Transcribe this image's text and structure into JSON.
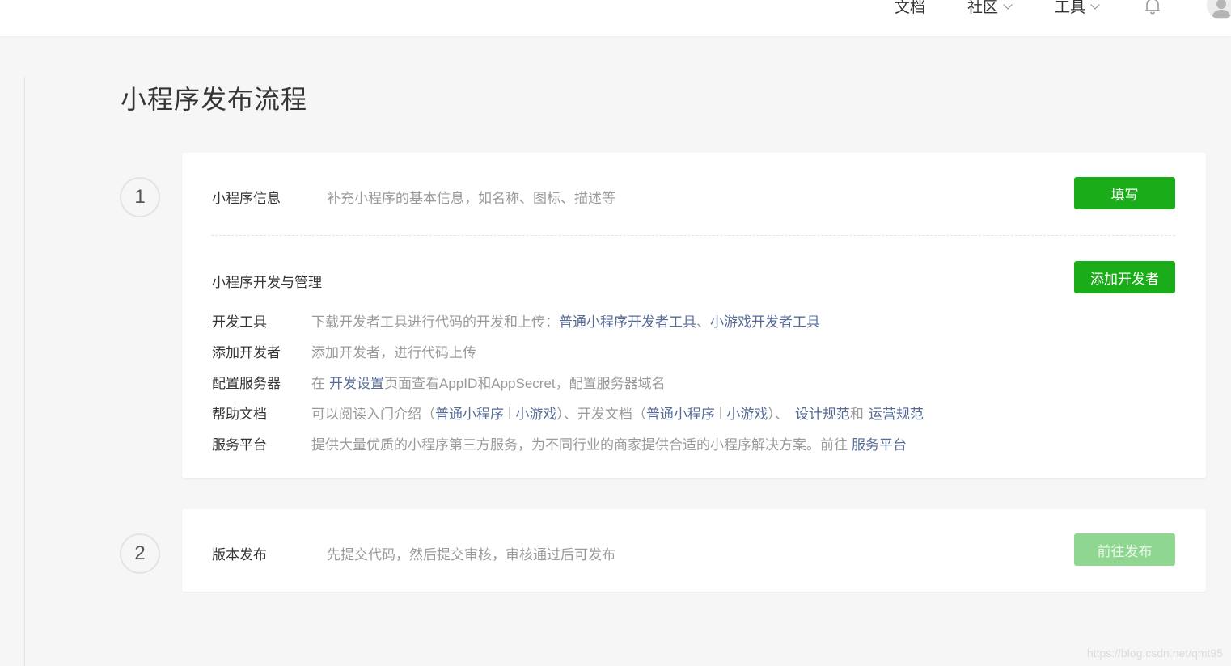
{
  "nav": {
    "docs": "文档",
    "community": "社区",
    "tools": "工具"
  },
  "page": {
    "title": "小程序发布流程"
  },
  "step1": {
    "number": "1",
    "info": {
      "label": "小程序信息",
      "desc": "补充小程序的基本信息，如名称、图标、描述等",
      "button": "填写"
    },
    "dev": {
      "label": "小程序开发与管理",
      "button": "添加开发者",
      "rows": {
        "tools": {
          "key": "开发工具",
          "prefix": "下载开发者工具进行代码的开发和上传：",
          "link1": "普通小程序开发者工具",
          "sep": "、",
          "link2": "小游戏开发者工具"
        },
        "addDev": {
          "key": "添加开发者",
          "text": "添加开发者，进行代码上传"
        },
        "server": {
          "key": "配置服务器",
          "pre": "在",
          "link": "开发设置",
          "post": "页面查看AppID和AppSecret，配置服务器域名"
        },
        "help": {
          "key": "帮助文档",
          "t1": "可以阅读入门介绍（",
          "l1": "普通小程序",
          "bar1": "|",
          "l2": "小游戏",
          "t2": "）、开发文档（",
          "l3": "普通小程序",
          "bar2": "|",
          "l4": "小游戏",
          "t3": "）、",
          "l5": "设计规范",
          "t4": "和",
          "l6": "运营规范"
        },
        "platform": {
          "key": "服务平台",
          "text": "提供大量优质的小程序第三方服务，为不同行业的商家提供合适的小程序解决方案。前往",
          "link": "服务平台"
        }
      }
    }
  },
  "step2": {
    "number": "2",
    "label": "版本发布",
    "desc": "先提交代码，然后提交审核，审核通过后可发布",
    "button": "前往发布"
  },
  "watermark": "https://blog.csdn.net/qmt95",
  "colors": {
    "primary": "#1aad19",
    "disabled": "#8fd690",
    "link": "#576b95",
    "muted": "#9a9a9a"
  }
}
